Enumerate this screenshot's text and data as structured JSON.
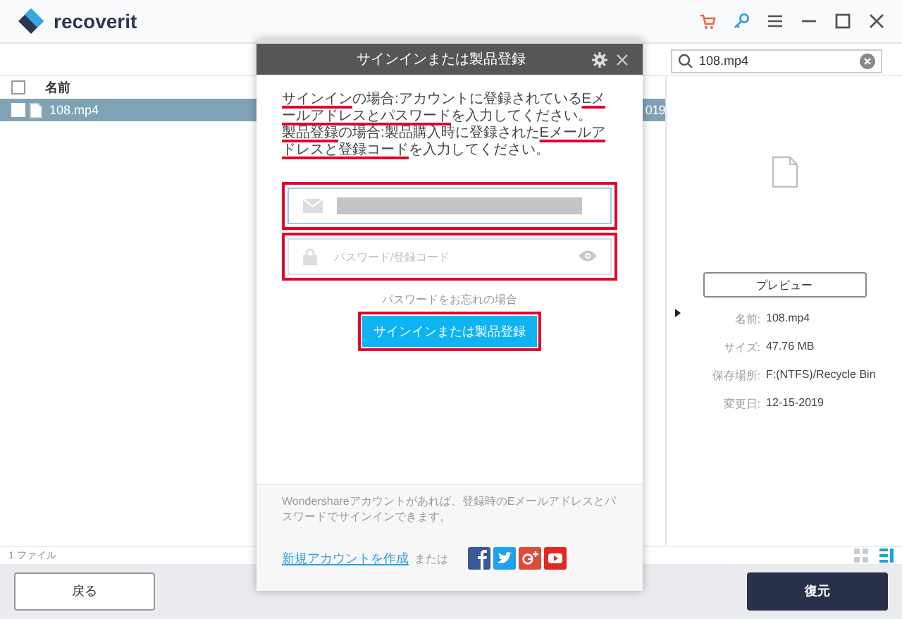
{
  "app": {
    "logo_text": "recoverit"
  },
  "search": {
    "value": "108.mp4"
  },
  "file_list": {
    "all_checked": false,
    "columns": [
      "名前"
    ],
    "rows": [
      {
        "name": "108.mp4",
        "date_fragment": "019",
        "selected": true,
        "checked": false
      }
    ]
  },
  "status_bar": {
    "count": "1 ファイル",
    "views": [
      {
        "kind": "grid",
        "selected": false
      },
      {
        "kind": "list",
        "selected": true
      }
    ]
  },
  "details": {
    "preview_button": "プレビュー",
    "fields": [
      {
        "label": "名前:",
        "value": "108.mp4"
      },
      {
        "label": "サイズ:",
        "value": "47.76  MB"
      },
      {
        "label": "保存場所:",
        "value": "F:(NTFS)/Recycle Bin"
      },
      {
        "label": "変更日:",
        "value": "12-15-2019"
      }
    ]
  },
  "footer_buttons": [
    {
      "label": "戻る",
      "kind": "secondary"
    },
    {
      "label": "復元",
      "kind": "primary"
    }
  ],
  "dialog": {
    "title": "サインインまたは製品登録",
    "instructions": [
      [
        {
          "text": "サインイン",
          "marked": true
        },
        {
          "text": "の場合:アカウントに登録されている",
          "marked": false
        },
        {
          "text": "Eメールアドレスとパスワード",
          "marked": true
        },
        {
          "text": "を入力してください。",
          "marked": false
        }
      ],
      [
        {
          "text": "製品登録",
          "marked": true
        },
        {
          "text": "の場合:製品購入時に登録された",
          "marked": false
        },
        {
          "text": "Eメールアドレスと登録コード",
          "marked": true
        },
        {
          "text": "を入力してください。",
          "marked": false
        }
      ]
    ],
    "email_field": {
      "redacted": true,
      "highlighted": true
    },
    "password_field": {
      "placeholder": "パスワード/登録コード",
      "highlighted": true
    },
    "forgot_link": "パスワードをお忘れの場合",
    "submit_button": {
      "label": "サインインまたは製品登録",
      "highlighted": true
    },
    "note": "Wondershareアカウントがあれば、登録時のEメールアドレスとパスワードでサインインできます。",
    "create_account_link": "新規アカウントを作成",
    "or_text": "または",
    "social": [
      {
        "kind": "facebook"
      },
      {
        "kind": "twitter"
      },
      {
        "kind": "google-plus"
      },
      {
        "kind": "youtube"
      }
    ]
  }
}
